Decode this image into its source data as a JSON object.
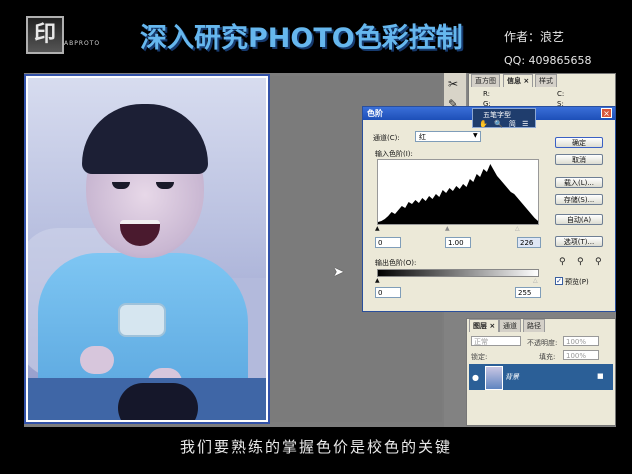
{
  "header": {
    "logo_mark": "印",
    "logo_sub": "ABPROTO",
    "title": "深入研究PHOTO色彩控制",
    "author": "作者：浪艺",
    "qq": "QQ:  409865658",
    "accent_color": "#66b7ee"
  },
  "info_panel": {
    "tabs": [
      "直方图",
      "信息 ×",
      "样式"
    ],
    "labels_left": [
      "R:",
      "G:"
    ],
    "labels_right": [
      "C:",
      "S:"
    ]
  },
  "ime": {
    "label": "五笔字型",
    "icons": "✋ 🔍 简 ☰"
  },
  "levels_dialog": {
    "title": "色阶",
    "channel_label": "通道(C):",
    "channel_value": "红",
    "input_label": "输入色阶(I):",
    "input_black": "0",
    "input_gamma": "1.00",
    "input_white": "226",
    "output_label": "输出色阶(O):",
    "output_black": "0",
    "output_white": "255",
    "buttons": [
      "确定",
      "取消",
      "载入(L)...",
      "存储(S)...",
      "自动(A)",
      "选项(T)..."
    ],
    "preview_label": "预览(P)",
    "preview_checked": true,
    "histogram": [
      2,
      3,
      5,
      8,
      12,
      10,
      14,
      18,
      16,
      22,
      20,
      24,
      21,
      26,
      23,
      28,
      25,
      30,
      27,
      34,
      31,
      36,
      33,
      38,
      35,
      40,
      37,
      45,
      42,
      50,
      47,
      55,
      52,
      60,
      54,
      48,
      44,
      40,
      36,
      32,
      30,
      26,
      22,
      18,
      14,
      10,
      6,
      3
    ]
  },
  "layers_panel": {
    "tabs": [
      "图层 ×",
      "通道",
      "路径"
    ],
    "blend_mode": "正常",
    "opacity_label": "不透明度:",
    "opacity_value": "100%",
    "lock_label": "锁定:",
    "fill_label": "填充:",
    "fill_value": "100%",
    "layer_name": "背景"
  },
  "caption": "我们要熟练的掌握色价是校色的关键"
}
